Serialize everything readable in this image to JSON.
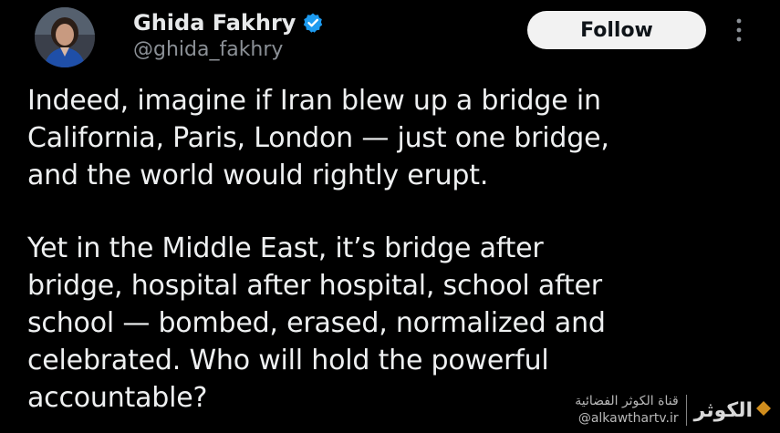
{
  "tweet": {
    "author": {
      "display_name": "Ghida Fakhry",
      "handle": "@ghida_fakhry",
      "verified_icon": "verified-badge-icon",
      "avatar": "avatar-photo"
    },
    "follow_label": "Follow",
    "more_icon": "more-options-icon",
    "paragraphs": [
      "Indeed, imagine if Iran blew up a bridge in\nCalifornia, Paris, London — just one bridge,\nand the world would rightly erupt.",
      "Yet in the Middle East, it’s bridge after\nbridge, hospital after hospital, school after\nschool — bombed, erased, normalized and\ncelebrated. Who will hold the powerful\naccountable?"
    ]
  },
  "watermark": {
    "channel_name": "قناة الكوثر الفضائية",
    "site": "@alkawthartv.ir",
    "logo_text": "الكوثر",
    "logo_icon": "alkawthar-diamond-logo-icon"
  },
  "colors": {
    "background": "#000000",
    "text_primary": "#e7e9ea",
    "text_secondary": "#8b9096",
    "verified_blue": "#1d9bf0",
    "follow_bg": "#f2f2f2",
    "logo_accent": "#f5a623"
  }
}
